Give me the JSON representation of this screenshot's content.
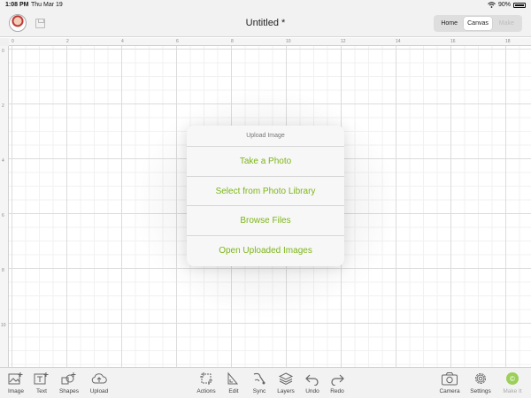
{
  "status_bar": {
    "time": "1:08 PM",
    "date": "Thu Mar 19",
    "battery": "90%",
    "battery_level": 0.9
  },
  "header": {
    "title": "Untitled *",
    "tabs": [
      {
        "label": "Home",
        "state": "normal"
      },
      {
        "label": "Canvas",
        "state": "active"
      },
      {
        "label": "Make",
        "state": "disabled"
      }
    ]
  },
  "rulers": {
    "top": [
      "0",
      "2",
      "4",
      "6",
      "8",
      "10",
      "12",
      "14",
      "16",
      "18"
    ],
    "left": [
      "0",
      "2",
      "4",
      "6",
      "8",
      "10"
    ]
  },
  "upload_popover": {
    "title": "Upload Image",
    "options": [
      "Take a Photo",
      "Select from Photo Library",
      "Browse Files",
      "Open Uploaded Images"
    ]
  },
  "toolbar": {
    "left": [
      {
        "label": "Image",
        "icon": "image-add-icon"
      },
      {
        "label": "Text",
        "icon": "text-add-icon"
      },
      {
        "label": "Shapes",
        "icon": "shapes-icon"
      },
      {
        "label": "Upload",
        "icon": "cloud-upload-icon"
      }
    ],
    "center": [
      {
        "label": "Actions",
        "icon": "actions-icon"
      },
      {
        "label": "Edit",
        "icon": "edit-icon"
      },
      {
        "label": "Sync",
        "icon": "sync-icon"
      },
      {
        "label": "Layers",
        "icon": "layers-icon"
      },
      {
        "label": "Undo",
        "icon": "undo-icon"
      },
      {
        "label": "Redo",
        "icon": "redo-icon"
      }
    ],
    "right": [
      {
        "label": "Camera",
        "icon": "camera-icon"
      },
      {
        "label": "Settings",
        "icon": "gear-icon"
      },
      {
        "label": "Make It",
        "icon": "make-it-icon"
      }
    ]
  },
  "colors": {
    "accent": "#7cb518",
    "make_it": "#9ccf5a",
    "bar_bg": "#f2f2f2"
  }
}
